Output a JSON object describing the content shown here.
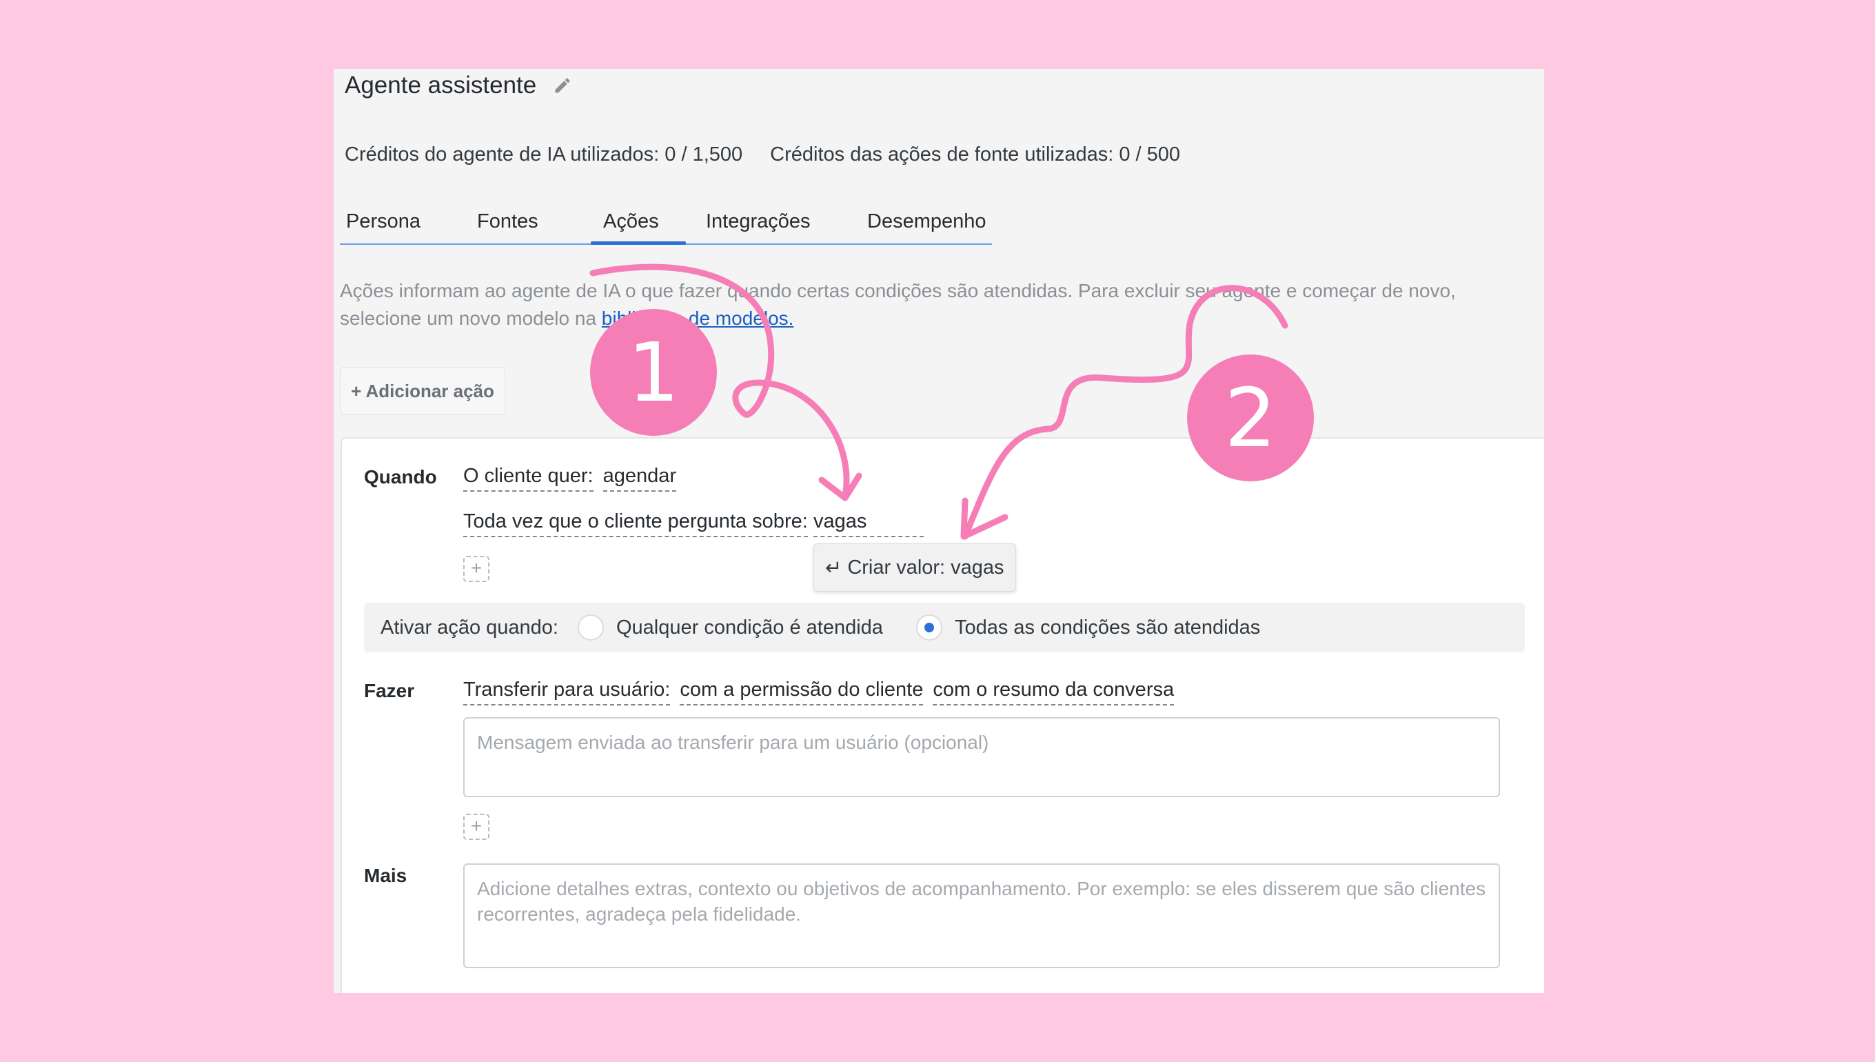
{
  "header": {
    "title": "Agente assistente",
    "credits_ai": "Créditos do agente de IA utilizados:  0 / 1,500",
    "credits_sources": "Créditos das ações de fonte utilizadas:  0 / 500"
  },
  "tabs": [
    {
      "label": "Persona"
    },
    {
      "label": "Fontes"
    },
    {
      "label": "Ações",
      "active": true
    },
    {
      "label": "Integrações"
    },
    {
      "label": "Desempenho"
    }
  ],
  "description": {
    "text": "Ações informam ao agente de IA o que fazer quando certas condições são atendidas. Para excluir seu agente e começar de novo, selecione um novo modelo na ",
    "link": "biblioteca de modelos."
  },
  "add_action_label": "+ Adicionar ação",
  "when": {
    "label": "Quando",
    "cond1_key": "O cliente quer:",
    "cond1_value": "agendar",
    "cond2_key": "Toda vez que o cliente pergunta sobre:",
    "cond2_value": "vagas",
    "dropdown_label": "Criar valor: vagas",
    "plus": "+"
  },
  "activate": {
    "label": "Ativar ação quando:",
    "option_any": "Qualquer condição é atendida",
    "option_all": "Todas as condições são atendidas",
    "selected": "all"
  },
  "do": {
    "label": "Fazer",
    "action": "Transferir para usuário:",
    "opt1": "com a permissão do cliente",
    "opt2": "com o resumo da conversa",
    "message_placeholder": "Mensagem enviada ao transferir para um usuário (opcional)",
    "plus": "+"
  },
  "more": {
    "label": "Mais",
    "placeholder": "Adicione detalhes extras, contexto ou objetivos de acompanhamento. Por exemplo: se eles disserem que são clientes recorrentes, agradeça pela fidelidade."
  },
  "annotations": {
    "badge1": "1",
    "badge2": "2",
    "color": "#f57eb6"
  },
  "colors": {
    "background": "#ffc9e1",
    "accent": "#2f6fd6",
    "link": "#1a5fc4"
  }
}
